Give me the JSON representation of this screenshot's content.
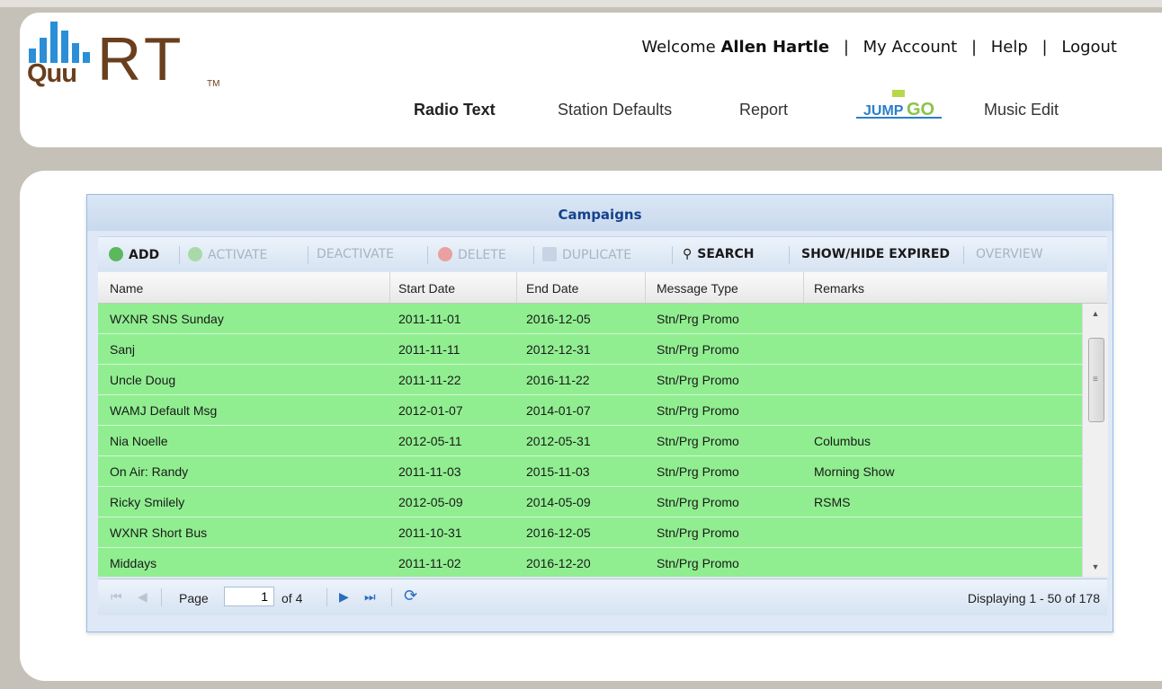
{
  "header": {
    "logo_text_main": "RT",
    "logo_text_sub": "Quu",
    "logo_tm": "TM",
    "welcome_prefix": "Welcome",
    "user_name": "Allen Hartle",
    "links": [
      "My Account",
      "Help",
      "Logout"
    ],
    "nav": {
      "radio_text": "Radio Text",
      "station_defaults": "Station Defaults",
      "report": "Report",
      "jumpgo_logo": "JumpGO",
      "music_edit": "Music Edit"
    }
  },
  "panel": {
    "title": "Campaigns",
    "toolbar": {
      "add": "ADD",
      "activate": "ACTIVATE",
      "deactivate": "DEACTIVATE",
      "delete": "DELETE",
      "duplicate": "DUPLICATE",
      "search": "SEARCH",
      "show_hide": "SHOW/HIDE EXPIRED",
      "overview": "OVERVIEW"
    },
    "columns": [
      "Name",
      "Start Date",
      "End Date",
      "Message Type",
      "Remarks"
    ],
    "rows": [
      [
        "WXNR SNS Sunday",
        "2011-11-01",
        "2016-12-05",
        "Stn/Prg Promo",
        ""
      ],
      [
        "Sanj",
        "2011-11-11",
        "2012-12-31",
        "Stn/Prg Promo",
        ""
      ],
      [
        "Uncle Doug",
        "2011-11-22",
        "2016-11-22",
        "Stn/Prg Promo",
        ""
      ],
      [
        "WAMJ Default Msg",
        "2012-01-07",
        "2014-01-07",
        "Stn/Prg Promo",
        ""
      ],
      [
        "Nia Noelle",
        "2012-05-11",
        "2012-05-31",
        "Stn/Prg Promo",
        "Columbus"
      ],
      [
        "On Air: Randy",
        "2011-11-03",
        "2015-11-03",
        "Stn/Prg Promo",
        "Morning Show"
      ],
      [
        "Ricky Smilely",
        "2012-05-09",
        "2014-05-09",
        "Stn/Prg Promo",
        "RSMS"
      ],
      [
        "WXNR Short Bus",
        "2011-10-31",
        "2016-12-05",
        "Stn/Prg Promo",
        ""
      ],
      [
        "Middays",
        "2011-11-02",
        "2016-12-20",
        "Stn/Prg Promo",
        ""
      ]
    ],
    "pager": {
      "page_label": "Page",
      "page_value": "1",
      "of_label": "of 4",
      "display_text": "Displaying 1 - 50 of 178"
    }
  },
  "colors": {
    "row_bg": "#90ee90",
    "title_color": "#15428b",
    "brand_brown": "#6a3f1e",
    "brand_blue": "#2a8fd6"
  }
}
